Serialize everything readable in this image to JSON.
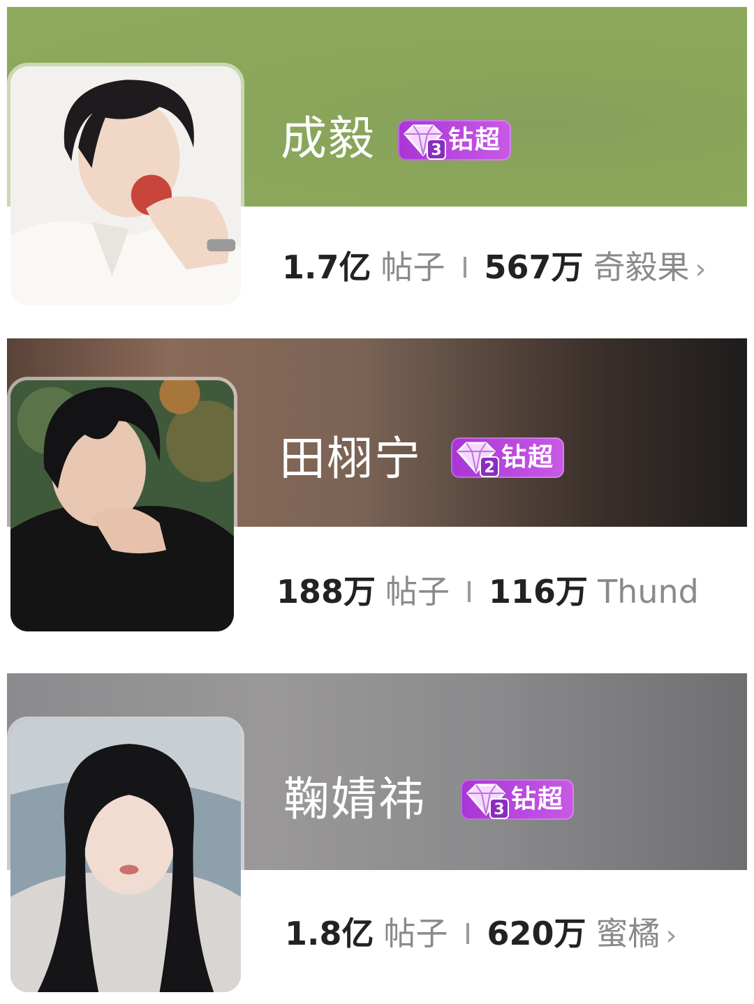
{
  "colors": {
    "badge": "#b540dc",
    "card1_banner": "#8aa65a",
    "card2_banner": "#4a3b33",
    "card3_banner": "#8b8a8c"
  },
  "cards": [
    {
      "name": "成毅",
      "badge": {
        "level": "3",
        "label": "钻超"
      },
      "posts_count": "1.7亿",
      "posts_label": "帖子",
      "fans_count": "567万",
      "fans_label": "奇毅果",
      "chevron": "›"
    },
    {
      "name": "田栩宁",
      "badge": {
        "level": "2",
        "label": "钻超"
      },
      "posts_count": "188万",
      "posts_label": "帖子",
      "fans_count": "116万",
      "fans_label": "Thund",
      "chevron": ""
    },
    {
      "name": "鞠婧祎",
      "badge": {
        "level": "3",
        "label": "钻超"
      },
      "posts_count": "1.8亿",
      "posts_label": "帖子",
      "fans_count": "620万",
      "fans_label": "蜜橘",
      "chevron": "›"
    }
  ]
}
